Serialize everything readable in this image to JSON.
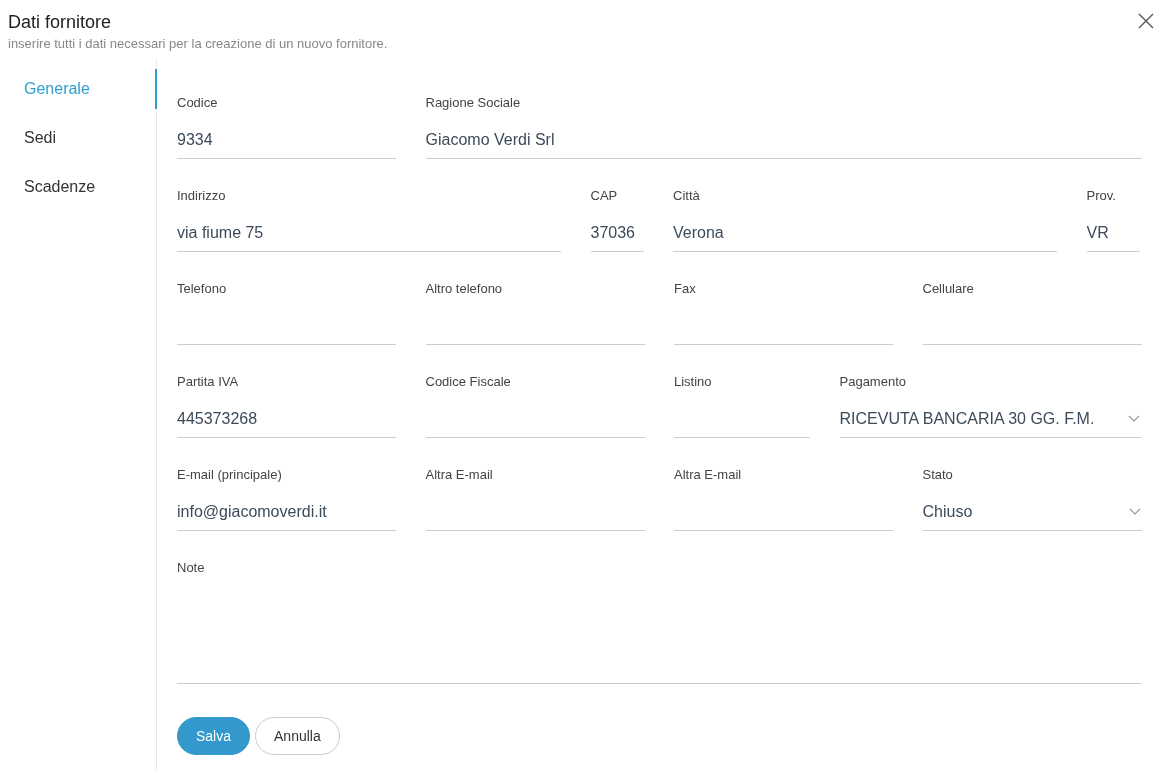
{
  "dialog": {
    "title": "Dati fornitore",
    "subtitle": "inserire tutti i dati necessari per la creazione di un nuovo fornitore."
  },
  "tabs": [
    {
      "label": "Generale",
      "selected": true
    },
    {
      "label": "Sedi",
      "selected": false
    },
    {
      "label": "Scadenze",
      "selected": false
    }
  ],
  "rows": [
    [
      {
        "label": "Codice",
        "kind": "text",
        "value": "9334"
      },
      {
        "label": "Ragione Sociale",
        "kind": "text",
        "value": "Giacomo Verdi Srl"
      }
    ],
    [
      {
        "label": "Indirizzo",
        "kind": "text",
        "value": "via fiume 75"
      },
      {
        "label": "CAP",
        "kind": "text",
        "value": "37036"
      },
      {
        "label": "Città",
        "kind": "text",
        "value": "Verona"
      },
      {
        "label": "Prov.",
        "kind": "text",
        "value": "VR"
      }
    ],
    [
      {
        "label": "Telefono",
        "kind": "text"
      },
      {
        "label": "Altro telefono",
        "kind": "text"
      },
      {
        "label": "Fax",
        "kind": "text"
      },
      {
        "label": "Cellulare",
        "kind": "text"
      }
    ],
    [
      {
        "label": "Partita IVA",
        "kind": "text",
        "value": "445373268"
      },
      {
        "label": "Codice Fiscale",
        "kind": "text"
      },
      {
        "label": "Listino",
        "kind": "text"
      },
      {
        "label": "Pagamento",
        "kind": "select",
        "value": "RICEVUTA BANCARIA 30 GG. F.M."
      }
    ],
    [
      {
        "label": "E-mail (principale)",
        "kind": "text",
        "value": "info@giacomoverdi.it"
      },
      {
        "label": "Altra E-mail",
        "kind": "text"
      },
      {
        "label": "Altra E-mail",
        "kind": "text"
      },
      {
        "label": "Stato",
        "kind": "select",
        "value": "Chiuso"
      }
    ]
  ],
  "note": {
    "label": "Note"
  },
  "buttons": [
    {
      "label": "Salva",
      "kind": "primary"
    },
    {
      "label": "Annulla",
      "kind": "secondary"
    }
  ]
}
